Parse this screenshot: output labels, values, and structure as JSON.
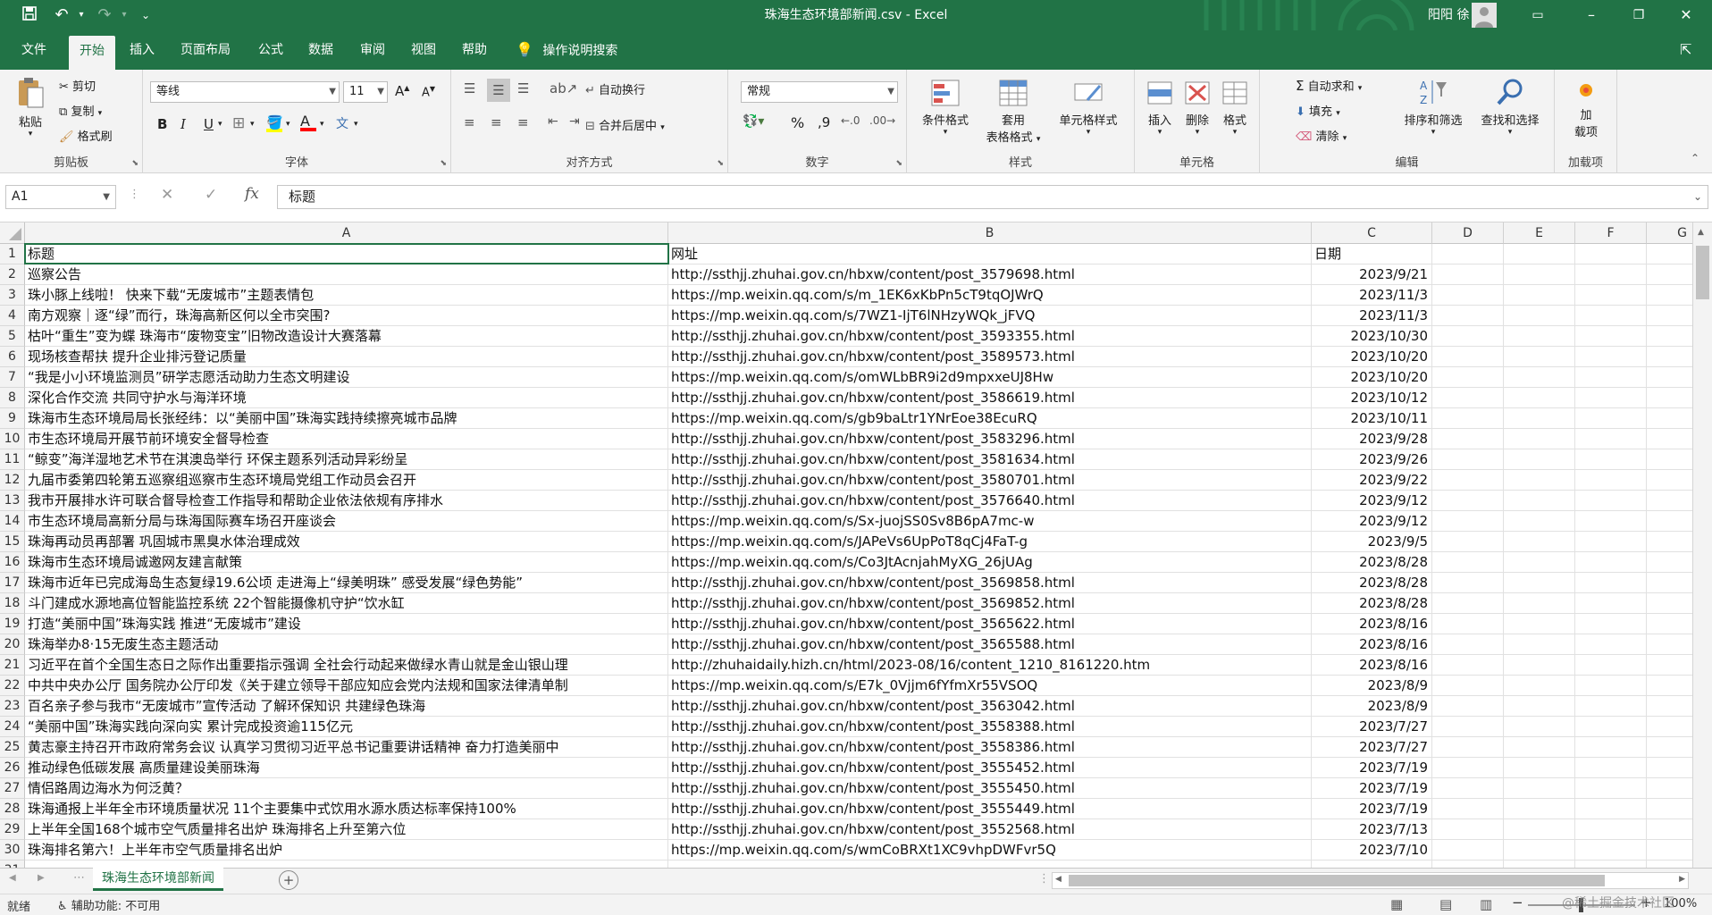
{
  "titlebar": {
    "title": "珠海生态环境部新闻.csv  -  Excel",
    "user": "阳阳 徐"
  },
  "tabs": [
    "文件",
    "开始",
    "插入",
    "页面布局",
    "公式",
    "数据",
    "审阅",
    "视图",
    "帮助"
  ],
  "tell_me": "操作说明搜索",
  "ribbon": {
    "clipboard": {
      "paste": "粘贴",
      "cut": "剪切",
      "copy": "复制",
      "painter": "格式刷",
      "label": "剪贴板"
    },
    "font": {
      "name": "等线",
      "size": "11",
      "grow": "A",
      "shrink": "A",
      "bold": "B",
      "italic": "I",
      "underline": "U",
      "color": "A",
      "phonetic": "文",
      "label": "字体"
    },
    "alignment": {
      "wrap": "自动换行",
      "merge": "合并后居中",
      "label": "对齐方式"
    },
    "number": {
      "format": "常规",
      "percent": "%",
      "comma": "9",
      "label": "数字"
    },
    "styles": {
      "conditional": "条件格式",
      "table": "套用",
      "table2": "表格格式",
      "cell": "单元格样式",
      "label": "样式"
    },
    "cells": {
      "insert": "插入",
      "delete": "删除",
      "format": "格式",
      "label": "单元格"
    },
    "editing": {
      "autosum": "自动求和",
      "fill": "填充",
      "clear": "清除",
      "sort": "排序和筛选",
      "find": "查找和选择",
      "label": "编辑"
    },
    "addins": {
      "addins": "加",
      "addins2": "载项",
      "label": "加载项"
    }
  },
  "formula": {
    "namebox": "A1",
    "content": "标题"
  },
  "columns": [
    "A",
    "B",
    "C",
    "D",
    "E",
    "F",
    "G"
  ],
  "rows": [
    [
      "标题",
      "网址",
      "日期"
    ],
    [
      "巡察公告",
      "http://ssthjj.zhuhai.gov.cn/hbxw/content/post_3579698.html",
      "2023/9/21"
    ],
    [
      "珠小豚上线啦！ 快来下载“无废城市”主题表情包",
      "https://mp.weixin.qq.com/s/m_1EK6xKbPn5cT9tqOJWrQ",
      "2023/11/3"
    ],
    [
      "南方观察｜逐“绿”而行，珠海高新区何以全市突围?",
      "https://mp.weixin.qq.com/s/7WZ1-IjT6lNHzyWQk_jFVQ",
      "2023/11/3"
    ],
    [
      "枯叶“重生”变为蝶  珠海市“废物变宝”旧物改造设计大赛落幕",
      "http://ssthjj.zhuhai.gov.cn/hbxw/content/post_3593355.html",
      "2023/10/30"
    ],
    [
      "现场核查帮扶  提升企业排污登记质量",
      "http://ssthjj.zhuhai.gov.cn/hbxw/content/post_3589573.html",
      "2023/10/20"
    ],
    [
      "“我是小小环境监测员”研学志愿活动助力生态文明建设",
      "https://mp.weixin.qq.com/s/omWLbBR9i2d9mpxxeUJ8Hw",
      "2023/10/20"
    ],
    [
      "深化合作交流 共同守护水与海洋环境",
      "http://ssthjj.zhuhai.gov.cn/hbxw/content/post_3586619.html",
      "2023/10/12"
    ],
    [
      "珠海市生态环境局局长张经纬：以“美丽中国”珠海实践持续擦亮城市品牌",
      "https://mp.weixin.qq.com/s/gb9baLtr1YNrEoe38EcuRQ",
      "2023/10/11"
    ],
    [
      "市生态环境局开展节前环境安全督导检查",
      "http://ssthjj.zhuhai.gov.cn/hbxw/content/post_3583296.html",
      "2023/9/28"
    ],
    [
      "“鲸变”海洋湿地艺术节在淇澳岛举行 环保主题系列活动异彩纷呈",
      "http://ssthjj.zhuhai.gov.cn/hbxw/content/post_3581634.html",
      "2023/9/26"
    ],
    [
      "九届市委第四轮第五巡察组巡察市生态环境局党组工作动员会召开",
      "http://ssthjj.zhuhai.gov.cn/hbxw/content/post_3580701.html",
      "2023/9/22"
    ],
    [
      "我市开展排水许可联合督导检查工作指导和帮助企业依法依规有序排水",
      "http://ssthjj.zhuhai.gov.cn/hbxw/content/post_3576640.html",
      "2023/9/12"
    ],
    [
      "市生态环境局高新分局与珠海国际赛车场召开座谈会",
      "https://mp.weixin.qq.com/s/Sx-juojSS0Sv8B6pA7mc-w",
      "2023/9/12"
    ],
    [
      "珠海再动员再部署 巩固城市黑臭水体治理成效",
      "https://mp.weixin.qq.com/s/JAPeVs6UpPoT8qCj4FaT-g",
      "2023/9/5"
    ],
    [
      "珠海市生态环境局诚邀网友建言献策",
      "https://mp.weixin.qq.com/s/Co3JtAcnjahMyXG_26jUAg",
      "2023/8/28"
    ],
    [
      "珠海市近年已完成海岛生态复绿19.6公顷 走进海上“绿美明珠” 感受发展“绿色势能”",
      "http://ssthjj.zhuhai.gov.cn/hbxw/content/post_3569858.html",
      "2023/8/28"
    ],
    [
      "斗门建成水源地高位智能监控系统 22个智能摄像机守护“饮水缸",
      "http://ssthjj.zhuhai.gov.cn/hbxw/content/post_3569852.html",
      "2023/8/28"
    ],
    [
      "打造“美丽中国”珠海实践 推进“无废城市”建设",
      "http://ssthjj.zhuhai.gov.cn/hbxw/content/post_3565622.html",
      "2023/8/16"
    ],
    [
      "珠海举办8·15无废生态主题活动",
      "http://ssthjj.zhuhai.gov.cn/hbxw/content/post_3565588.html",
      "2023/8/16"
    ],
    [
      "习近平在首个全国生态日之际作出重要指示强调 全社会行动起来做绿水青山就是金山银山理",
      "http://zhuhaidaily.hizh.cn/html/2023-08/16/content_1210_8161220.htm",
      "2023/8/16"
    ],
    [
      "中共中央办公厅 国务院办公厅印发《关于建立领导干部应知应会党内法规和国家法律清单制",
      "https://mp.weixin.qq.com/s/E7k_0Vjjm6fYfmXr55VSOQ",
      "2023/8/9"
    ],
    [
      "百名亲子参与我市“无废城市”宣传活动 了解环保知识 共建绿色珠海",
      "http://ssthjj.zhuhai.gov.cn/hbxw/content/post_3563042.html",
      "2023/8/9"
    ],
    [
      "“美丽中国”珠海实践向深向实 累计完成投资逾115亿元",
      "http://ssthjj.zhuhai.gov.cn/hbxw/content/post_3558388.html",
      "2023/7/27"
    ],
    [
      "黄志豪主持召开市政府常务会议 认真学习贯彻习近平总书记重要讲话精神 奋力打造美丽中",
      "http://ssthjj.zhuhai.gov.cn/hbxw/content/post_3558386.html",
      "2023/7/27"
    ],
    [
      "推动绿色低碳发展 高质量建设美丽珠海",
      "http://ssthjj.zhuhai.gov.cn/hbxw/content/post_3555452.html",
      "2023/7/19"
    ],
    [
      "情侣路周边海水为何泛黄？",
      "http://ssthjj.zhuhai.gov.cn/hbxw/content/post_3555450.html",
      "2023/7/19"
    ],
    [
      "珠海通报上半年全市环境质量状况 11个主要集中式饮用水源水质达标率保持100%",
      "http://ssthjj.zhuhai.gov.cn/hbxw/content/post_3555449.html",
      "2023/7/19"
    ],
    [
      "上半年全国168个城市空气质量排名出炉  珠海排名上升至第六位",
      "http://ssthjj.zhuhai.gov.cn/hbxw/content/post_3552568.html",
      "2023/7/13"
    ],
    [
      "珠海排名第六！上半年市空气质量排名出炉",
      "https://mp.weixin.qq.com/s/wmCoBRXt1XC9vhpDWFvr5Q",
      "2023/7/10"
    ]
  ],
  "sheet": {
    "name": "珠海生态环境部新闻"
  },
  "status": {
    "ready": "就绪",
    "accessibility": "辅助功能: 不可用",
    "zoom": "100%",
    "watermark": "@稀土掘金技术社区"
  },
  "colors": {
    "accent": "#217346"
  }
}
